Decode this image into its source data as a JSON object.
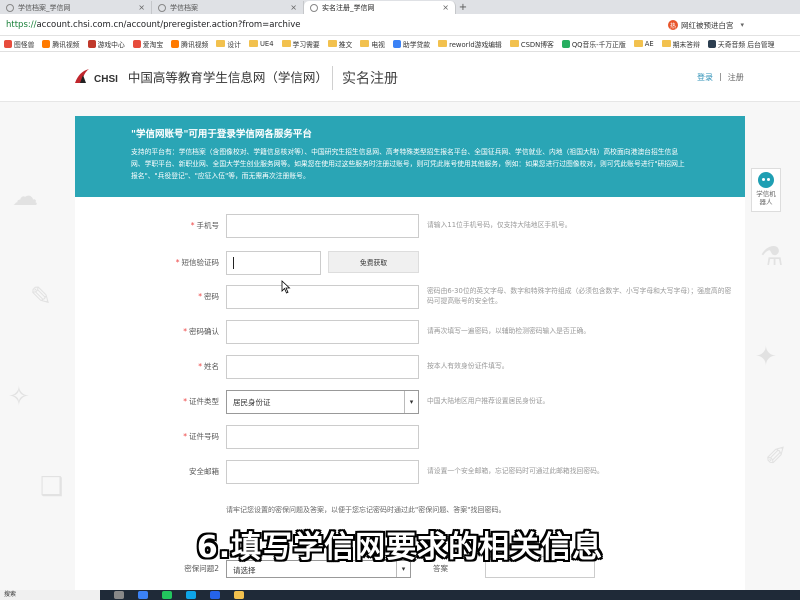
{
  "browser": {
    "tabs": [
      {
        "label": "学信档案_学信网",
        "active": false
      },
      {
        "label": "学信档案",
        "active": false
      },
      {
        "label": "实名注册_学信网",
        "active": true
      }
    ],
    "tab_close": "×",
    "new_tab": "+",
    "url_proto": "https://",
    "url_rest": "account.chsi.com.cn/account/preregister.action?from=archive",
    "hot_news": "网红被预进白宫",
    "hot_icon": "热",
    "bookmarks": [
      {
        "label": "图怪兽",
        "icon": "dot",
        "color": "#e74c3c"
      },
      {
        "label": "腾讯视频",
        "icon": "dot",
        "color": "#ff7a00"
      },
      {
        "label": "游戏中心",
        "icon": "dot",
        "color": "#c0392b"
      },
      {
        "label": "爱淘宝",
        "icon": "dot",
        "color": "#e74c3c"
      },
      {
        "label": "腾讯视频",
        "icon": "dot",
        "color": "#ff7a00"
      },
      {
        "label": "设计",
        "icon": "folder"
      },
      {
        "label": "UE4",
        "icon": "folder"
      },
      {
        "label": "学习需要",
        "icon": "folder"
      },
      {
        "label": "推文",
        "icon": "folder"
      },
      {
        "label": "电视",
        "icon": "folder"
      },
      {
        "label": "助学贷款",
        "icon": "dot",
        "color": "#3b82f6"
      },
      {
        "label": "reworld游戏编辑",
        "icon": "folder"
      },
      {
        "label": "CSDN博客",
        "icon": "folder"
      },
      {
        "label": "QQ音乐-千万正版",
        "icon": "dot",
        "color": "#27ae60"
      },
      {
        "label": "AE",
        "icon": "folder"
      },
      {
        "label": "期末答辩",
        "icon": "folder"
      },
      {
        "label": "天奇音频 后台管理",
        "icon": "dot",
        "color": "#2c3e50"
      }
    ]
  },
  "header": {
    "logo_chsi": "CHSI",
    "logo_name": "中国高等教育学生信息网（学信网）",
    "title": "实名注册",
    "login": "登录",
    "separator": "|",
    "register": "注册"
  },
  "robot": {
    "label": "学信机器人"
  },
  "notice": {
    "title": "\"学信网账号\"可用于登录学信网各服务平台",
    "body": "支持的平台有：学信档案（含图像校对、学籍信息核对等）、中国研究生招生信息网、高考特殊类型招生报名平台、全国征兵网、学信就业、内地（祖国大陆）高校面向港澳台招生信息网、学职平台、新职业网、全国大学生创业服务网等。如果您在使用过这些服务时注册过账号，则可凭此账号使用其他服务，例如：如果您进行过图像校对，则可凭此账号进行\"研招网上报名\"、\"兵役登记\"、\"应征入伍\"等，而无需再次注册账号。"
  },
  "form": {
    "required_mark": "*",
    "phone": {
      "label": "手机号",
      "value": "",
      "hint": "请输入11位手机号码，仅支持大陆地区手机号。"
    },
    "sms": {
      "label": "短信验证码",
      "value": "",
      "button": "免费获取"
    },
    "password": {
      "label": "密码",
      "value": "",
      "hint": "密码由6-30位的英文字母、数字和特殊字符组成（必须包含数字、小写字母和大写字母）；强度高的密码可提高账号的安全性。"
    },
    "password_confirm": {
      "label": "密码确认",
      "value": "",
      "hint": "请再次填写一遍密码，以辅助检测密码输入是否正确。"
    },
    "name": {
      "label": "姓名",
      "value": "",
      "hint": "按本人有效身份证件填写。"
    },
    "id_type": {
      "label": "证件类型",
      "value": "居民身份证",
      "hint": "中国大陆地区用户推荐设置居民身份证。"
    },
    "id_number": {
      "label": "证件号码",
      "value": ""
    },
    "email": {
      "label": "安全邮箱",
      "value": "",
      "hint": "请设置一个安全邮箱，忘记密码时可通过此邮箱找回密码。"
    },
    "security_note": "请牢记您设置的密保问题及答案，以便于您忘记密码时通过此\"密保问题、答案\"找回密码。",
    "question2": {
      "label": "密保问题2",
      "value": "请选择"
    },
    "answer": {
      "label": "答案"
    }
  },
  "caption": "6.填写学信网要求的相关信息",
  "taskbar": {
    "search": "搜索"
  }
}
